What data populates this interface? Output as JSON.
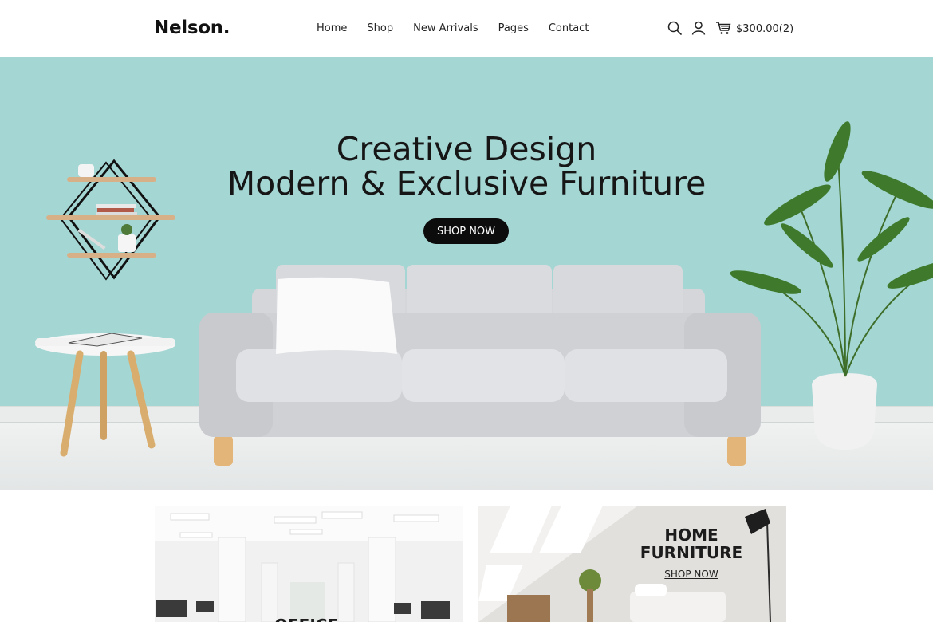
{
  "brand": {
    "logo": "Nelson."
  },
  "nav": {
    "items": [
      "Home",
      "Shop",
      "New Arrivals",
      "Pages",
      "Contact"
    ]
  },
  "header_actions": {
    "search_icon": "search-icon",
    "user_icon": "user-icon",
    "cart_icon": "cart-icon",
    "cart_total": "$300.00(2)"
  },
  "hero": {
    "title_line1": "Creative Design",
    "title_line2": "Modern & Exclusive Furniture",
    "cta_label": "SHOP NOW",
    "background_color": "#a4d6d3"
  },
  "promos": {
    "office": {
      "title": "OFFICE"
    },
    "home": {
      "title_line1": "HOME",
      "title_line2": "FURNITURE",
      "link_label": "SHOP NOW"
    }
  }
}
